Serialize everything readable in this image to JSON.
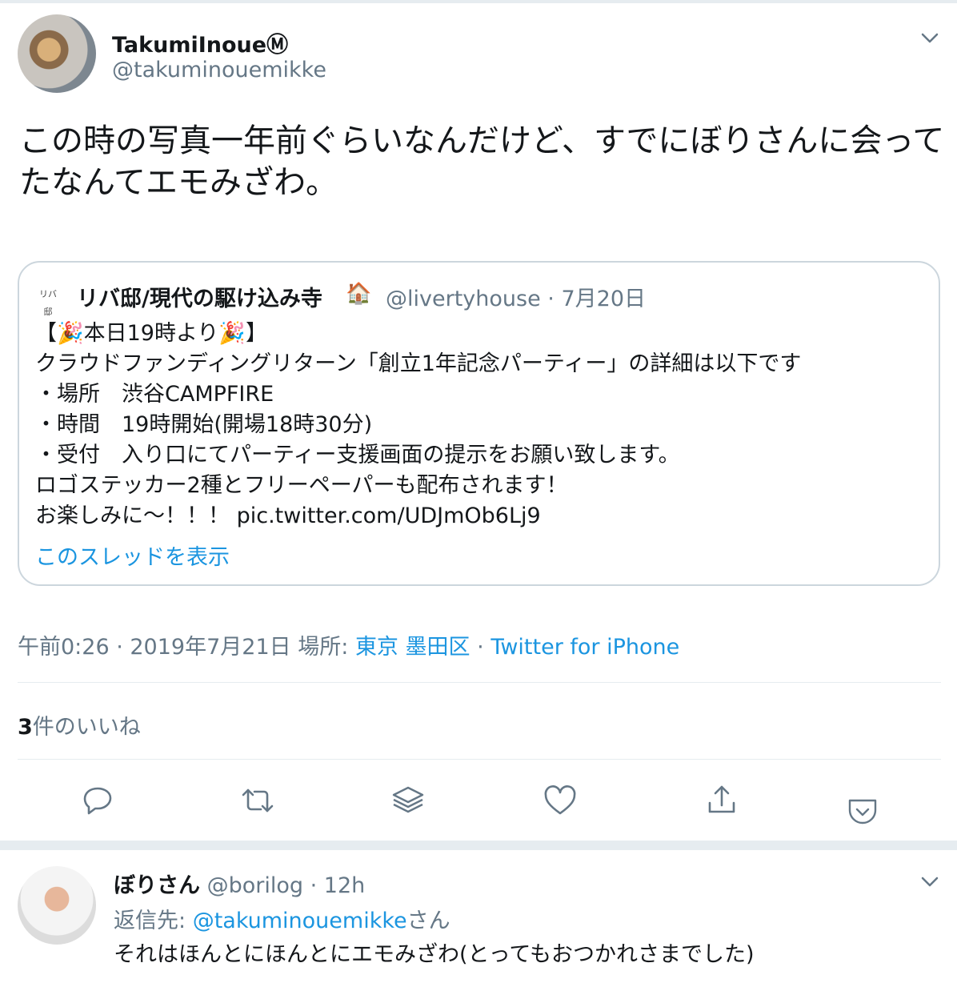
{
  "tweet": {
    "author_name": "TakumiInoueⓂ",
    "author_handle": "@takuminouemikke",
    "text": "この時の写真一年前ぐらいなんだけど、すでにぼりさんに会ってたなんてエモみざわ。",
    "quote": {
      "logo_text": "リバ邸",
      "author_name": "リバ邸/現代の駆け込み寺",
      "emoji": "🏠",
      "author_handle": "@livertyhouse",
      "dot": "·",
      "date": "7月20日",
      "body": "【🎉本日19時より🎉】\nクラウドファンディングリターン「創立1年記念パーティー」の詳細は以下です\n・場所　渋谷CAMPFIRE\n・時間　19時開始(開場18時30分)\n・受付　入り口にてパーティー支援画面の提示をお願い致します。\nロゴステッカー2種とフリーペーパーも配布されます！\nお楽しみに〜！！！ pic.twitter.com/UDJmOb6Lj9",
      "show_thread": "このスレッドを表示"
    },
    "time": "午前0:26 · 2019年7月21日",
    "location_label": "場所:",
    "location": "東京 墨田区",
    "dot": "·",
    "source": "Twitter for iPhone",
    "likes_count": "3",
    "likes_label": "件のいいね",
    "actions": [
      "reply-icon",
      "retweet-icon",
      "layers-icon",
      "heart-icon",
      "share-icon",
      "pocket-icon"
    ]
  },
  "reply": {
    "author_name": "ぼりさん",
    "author_handle": "@borilog",
    "dot": "·",
    "time": "12h",
    "reply_to_label": "返信先:",
    "reply_to_handle": "@takuminouemikke",
    "reply_to_suffix": "さん",
    "text": "それはほんとにほんとにエモみざわ(とってもおつかれさまでした)"
  },
  "colors": {
    "link": "#1b95e0",
    "muted": "#657786",
    "border": "#ccd6dd",
    "text": "#14171a"
  }
}
